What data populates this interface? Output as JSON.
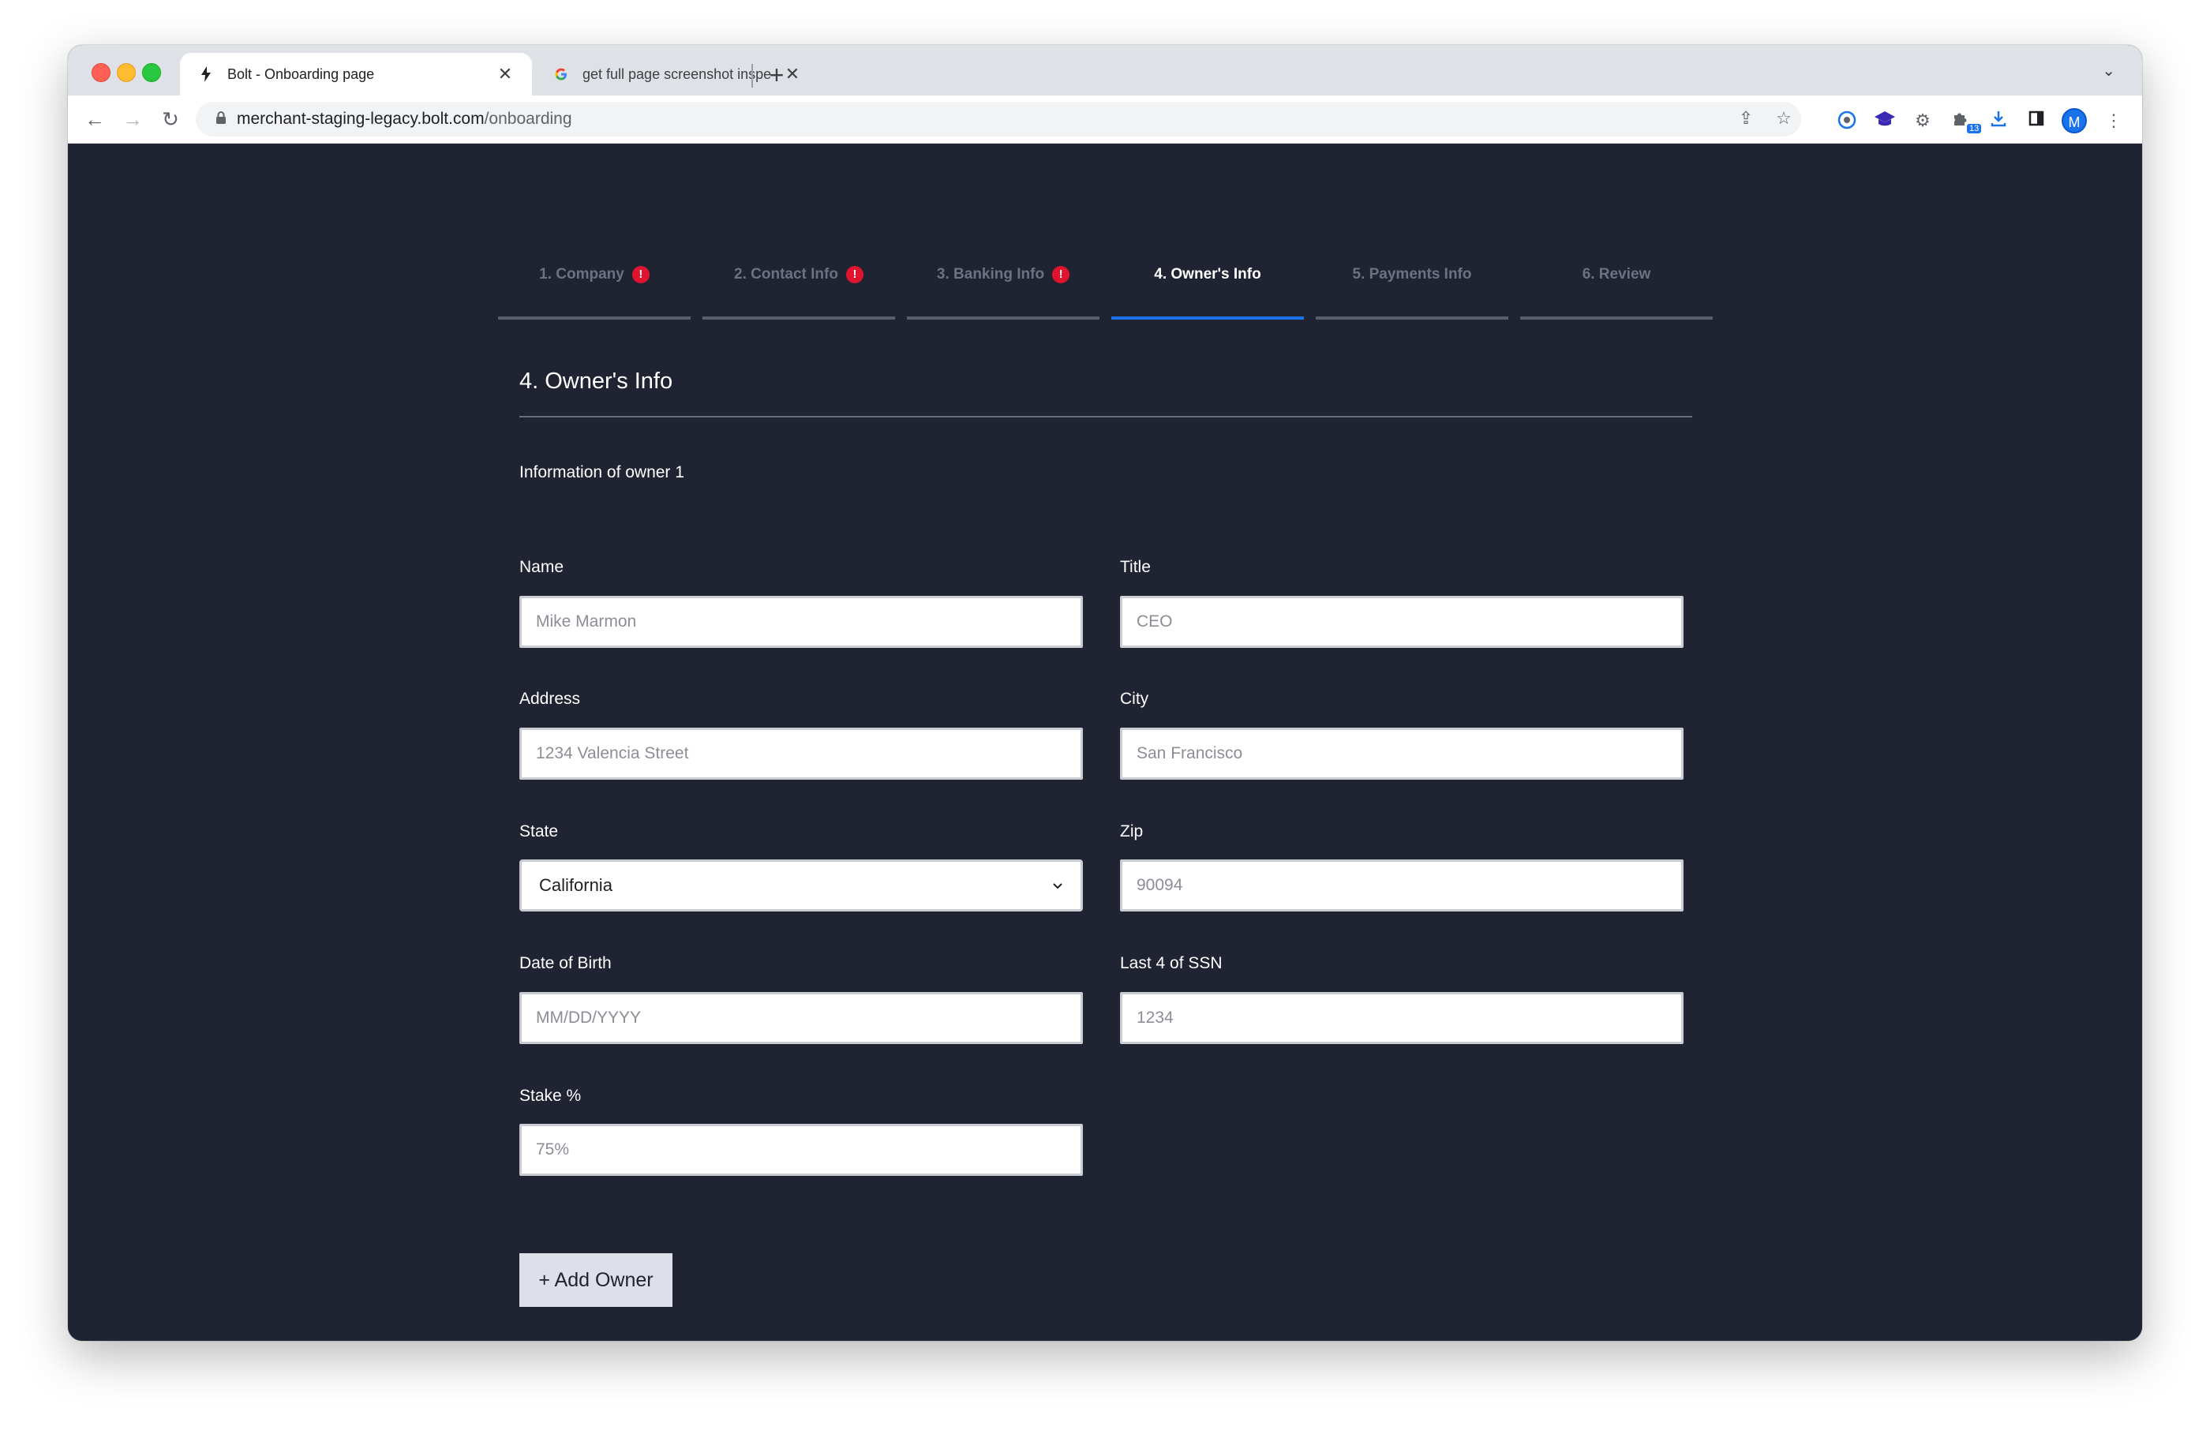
{
  "browser": {
    "tabs": [
      {
        "title": "Bolt - Onboarding page",
        "favicon": "bolt-icon",
        "active": true
      },
      {
        "title": "get full page screenshot inspe",
        "favicon": "google-icon",
        "active": false
      }
    ],
    "new_tab_symbol": "+",
    "url_domain": "merchant-staging-legacy.bolt.com",
    "url_path": "/onboarding",
    "profile_initial": "M",
    "extension_badge": "13"
  },
  "steps": [
    {
      "label": "1. Company",
      "warning": true,
      "active": false
    },
    {
      "label": "2. Contact Info",
      "warning": true,
      "active": false
    },
    {
      "label": "3. Banking Info",
      "warning": true,
      "active": false
    },
    {
      "label": "4. Owner's Info",
      "warning": false,
      "active": true
    },
    {
      "label": "5. Payments Info",
      "warning": false,
      "active": false
    },
    {
      "label": "6. Review",
      "warning": false,
      "active": false
    }
  ],
  "section": {
    "title": "4. Owner's Info",
    "subheading": "Information of owner 1"
  },
  "form": {
    "name": {
      "label": "Name",
      "placeholder": "Mike Marmon"
    },
    "title": {
      "label": "Title",
      "placeholder": "CEO"
    },
    "address": {
      "label": "Address",
      "placeholder": "1234 Valencia Street"
    },
    "city": {
      "label": "City",
      "placeholder": "San Francisco"
    },
    "state": {
      "label": "State",
      "value": "California"
    },
    "zip": {
      "label": "Zip",
      "placeholder": "90094"
    },
    "dob": {
      "label": "Date of Birth",
      "placeholder": "MM/DD/YYYY"
    },
    "ssn": {
      "label": "Last 4 of SSN",
      "placeholder": "1234"
    },
    "stake": {
      "label": "Stake %",
      "placeholder": "75%"
    }
  },
  "add_owner_label": "+ Add Owner",
  "colors": {
    "page_background": "#202331",
    "active_step": "#1a73e8",
    "warning": "#e0142f"
  }
}
